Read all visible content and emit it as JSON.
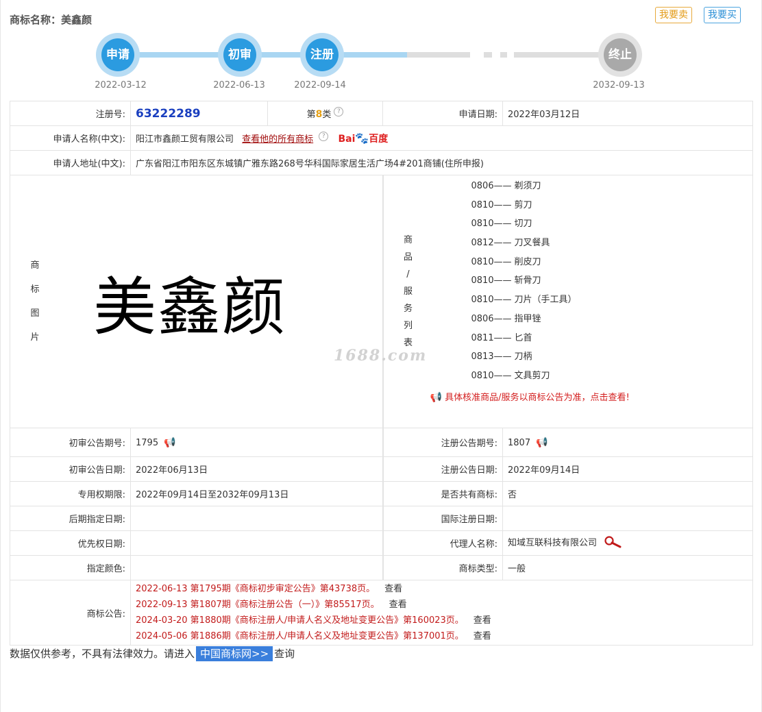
{
  "header": {
    "title": "商标名称：美鑫颜",
    "sell_label": "我要卖",
    "buy_label": "我要买"
  },
  "timeline": {
    "steps": [
      {
        "label": "申请",
        "date": "2022-03-12",
        "state": "done"
      },
      {
        "label": "初审",
        "date": "2022-06-13",
        "state": "done"
      },
      {
        "label": "注册",
        "date": "2022-09-14",
        "state": "done"
      },
      {
        "label": "终止",
        "date": "2032-09-13",
        "state": "pending"
      }
    ]
  },
  "colors": {
    "step_done": "#2b9be0",
    "step_pending": "#a9a9a9",
    "notice_red": "#c21b1b",
    "regno_blue": "#1a3fbf"
  },
  "info": {
    "reg_no_label": "注册号:",
    "reg_no": "63222289",
    "class_prefix": "第",
    "class_num": "8",
    "class_suffix": "类",
    "apply_date_label": "申请日期:",
    "apply_date": "2022年03月12日",
    "applicant_label": "申请人名称(中文):",
    "applicant": "阳江市鑫颜工贸有限公司",
    "applicant_link": "查看他的所有商标",
    "baidu_label": "百度",
    "address_label": "申请人地址(中文):",
    "address": "广东省阳江市阳东区东城镇广雅东路268号华科国际家居生活广场4#201商铺(住所申报)",
    "image_label_chars": [
      "商",
      "标",
      "图",
      "片"
    ],
    "mark_text": "美鑫颜",
    "goods_label_chars": [
      "商",
      "品",
      "/",
      "服",
      "务",
      "列",
      "表"
    ],
    "goods": [
      {
        "code": "0806",
        "name": "剃须刀"
      },
      {
        "code": "0810",
        "name": "剪刀"
      },
      {
        "code": "0810",
        "name": "切刀"
      },
      {
        "code": "0812",
        "name": "刀叉餐具"
      },
      {
        "code": "0810",
        "name": "削皮刀"
      },
      {
        "code": "0810",
        "name": "斩骨刀"
      },
      {
        "code": "0810",
        "name": "刀片（手工具）"
      },
      {
        "code": "0806",
        "name": "指甲锉"
      },
      {
        "code": "0811",
        "name": "匕首"
      },
      {
        "code": "0813",
        "name": "刀柄"
      },
      {
        "code": "0810",
        "name": "文具剪刀"
      }
    ],
    "goods_dash": "——",
    "goods_note": "具体核准商品/服务以商标公告为准，点击查看!",
    "watermark": "1688.com",
    "prelim_no_label": "初审公告期号:",
    "prelim_no": "1795",
    "reg_notice_no_label": "注册公告期号:",
    "reg_notice_no": "1807",
    "prelim_date_label": "初审公告日期:",
    "prelim_date": "2022年06月13日",
    "reg_notice_date_label": "注册公告日期:",
    "reg_notice_date": "2022年09月14日",
    "exclusive_label": "专用权期限:",
    "exclusive": "2022年09月14日至2032年09月13日",
    "shared_label": "是否共有商标:",
    "shared": "否",
    "later_label": "后期指定日期:",
    "later": "",
    "intl_label": "国际注册日期:",
    "intl": "",
    "priority_label": "优先权日期:",
    "priority": "",
    "agent_label": "代理人名称:",
    "agent": "知域互联科技有限公司",
    "color_label": "指定颜色:",
    "color": "",
    "type_label": "商标类型:",
    "type": "一般",
    "notices_label": "商标公告:",
    "notices": [
      {
        "text": "2022-06-13 第1795期《商标初步审定公告》第43738页。",
        "view": "查看"
      },
      {
        "text": "2022-09-13 第1807期《商标注册公告（一）》第85517页。",
        "view": "查看"
      },
      {
        "text": "2024-03-20 第1880期《商标注册人/申请人名义及地址变更公告》第160023页。",
        "view": "查看"
      },
      {
        "text": "2024-05-06 第1886期《商标注册人/申请人名义及地址变更公告》第137001页。",
        "view": "查看"
      }
    ]
  },
  "footer": {
    "prefix": "数据仅供参考，不具有法律效力。请进入",
    "link": "中国商标网>>",
    "suffix": "查询"
  }
}
